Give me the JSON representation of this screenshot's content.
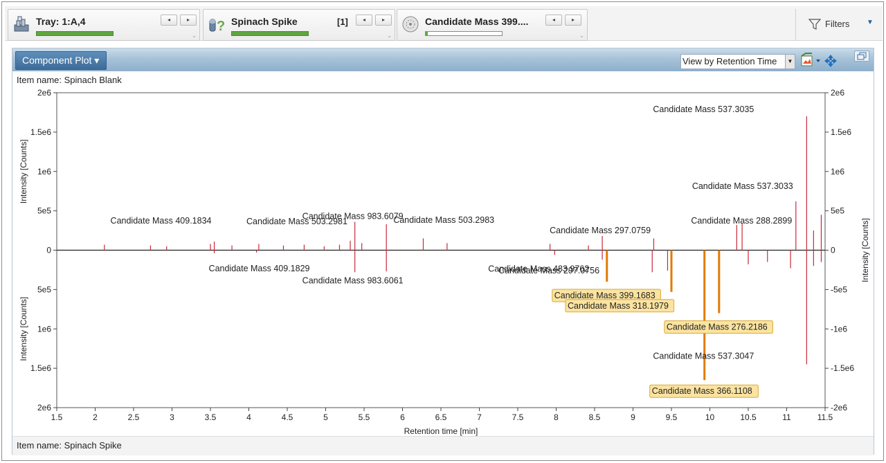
{
  "toolbar": {
    "tray": {
      "title": "Tray: 1:A,4",
      "icon": "tray-stack-icon",
      "progress": 1.0
    },
    "sample": {
      "title": "Spinach Spike",
      "count": "[1]",
      "icon": "sample-question-icon",
      "progress": 1.0
    },
    "component": {
      "title": "Candidate Mass 399....",
      "icon": "disc-icon",
      "progress": 0.03
    },
    "prev_label": "◂",
    "next_label": "▸",
    "filters_label": "Filters",
    "filters_icon": "funnel-icon"
  },
  "panel": {
    "title": "Component Plot ▾",
    "view_select": "View by Retention Time",
    "tool_icons": [
      "export-image-icon",
      "pan-move-icon",
      "restore-window-icon"
    ],
    "item_top": "Item name: Spinach Blank",
    "item_bottom": "Item name: Spinach Spike"
  },
  "chart_data": {
    "type": "bar",
    "xlabel": "Retention time [min]",
    "ylabel_left_top": "Intensity [Counts]",
    "ylabel_left_bottom": "Intensity [Counts]",
    "ylabel_right": "Intensity [Counts]",
    "xlim": [
      1.5,
      11.5
    ],
    "ylim": [
      -2000000,
      2000000
    ],
    "x_ticks": [
      "1.5",
      "2",
      "2.5",
      "3",
      "3.5",
      "4",
      "4.5",
      "5",
      "5.5",
      "6",
      "6.5",
      "7",
      "7.5",
      "8",
      "8.5",
      "9",
      "9.5",
      "10",
      "10.5",
      "11",
      "11.5"
    ],
    "y_ticks_left": [
      "2e6",
      "1.5e6",
      "1e6",
      "5e5",
      "0",
      "5e5",
      "1e6",
      "1.5e6",
      "2e6"
    ],
    "y_ticks_right": [
      "2e6",
      "1.5e6",
      "1e6",
      "5e5",
      "0",
      "-5e5",
      "-1e6",
      "-1.5e6",
      "-2e6"
    ],
    "colors": {
      "peak": "#c8283a",
      "highlight": "#e07b00",
      "label_bg": "#fbe3a0",
      "label_border": "#d9a93a"
    },
    "series": [
      {
        "name": "Spinach Blank",
        "peaks": [
          {
            "x": 2.12,
            "y": 70000
          },
          {
            "x": 2.72,
            "y": 60000
          },
          {
            "x": 2.93,
            "y": 50000
          },
          {
            "x": 3.5,
            "y": 80000
          },
          {
            "x": 3.55,
            "y": 110000,
            "label": "Candidate Mass 409.1834"
          },
          {
            "x": 3.78,
            "y": 60000
          },
          {
            "x": 4.13,
            "y": 80000
          },
          {
            "x": 4.45,
            "y": 60000
          },
          {
            "x": 4.72,
            "y": 70000
          },
          {
            "x": 4.98,
            "y": 50000
          },
          {
            "x": 5.18,
            "y": 70000
          },
          {
            "x": 5.32,
            "y": 120000,
            "label": "Candidate Mass 503.2981"
          },
          {
            "x": 5.38,
            "y": 360000,
            "label": "Candidate Mass 983.6079"
          },
          {
            "x": 5.47,
            "y": 90000
          },
          {
            "x": 5.79,
            "y": 330000,
            "label": "Candidate Mass 503.2983"
          },
          {
            "x": 6.27,
            "y": 150000
          },
          {
            "x": 6.58,
            "y": 90000
          },
          {
            "x": 7.92,
            "y": 80000
          },
          {
            "x": 8.42,
            "y": 60000
          },
          {
            "x": 8.6,
            "y": 180000,
            "label": "Candidate Mass 297.0759"
          },
          {
            "x": 9.27,
            "y": 150000
          },
          {
            "x": 10.35,
            "y": 320000,
            "label": "Candidate Mass 288.2899"
          },
          {
            "x": 10.42,
            "y": 350000
          },
          {
            "x": 11.12,
            "y": 620000,
            "label": "Candidate Mass 537.3033"
          },
          {
            "x": 11.26,
            "y": 1700000,
            "label": "Candidate Mass 537.3035"
          },
          {
            "x": 11.35,
            "y": 250000
          },
          {
            "x": 11.45,
            "y": 450000
          }
        ]
      },
      {
        "name": "Spinach Spike",
        "peaks": [
          {
            "x": 3.55,
            "y": -40000,
            "label": "Candidate Mass 409.1829"
          },
          {
            "x": 4.1,
            "y": -30000
          },
          {
            "x": 5.38,
            "y": -280000,
            "label": "Candidate Mass 983.6061"
          },
          {
            "x": 5.79,
            "y": -270000
          },
          {
            "x": 7.98,
            "y": -60000,
            "label": "Candidate Mass 483.9762"
          },
          {
            "x": 8.6,
            "y": -120000,
            "label": "Candidate Mass 297.0756"
          },
          {
            "x": 8.66,
            "y": -400000,
            "label": "Candidate Mass 399.1683",
            "highlight": true
          },
          {
            "x": 9.25,
            "y": -280000
          },
          {
            "x": 9.45,
            "y": -260000
          },
          {
            "x": 9.5,
            "y": -530000,
            "label": "Candidate Mass 318.1979",
            "highlight": true
          },
          {
            "x": 9.93,
            "y": -1650000,
            "label": "Candidate Mass 366.1108",
            "highlight": true
          },
          {
            "x": 10.12,
            "y": -800000,
            "label": "Candidate Mass 276.2186",
            "highlight": true
          },
          {
            "x": 10.5,
            "y": -180000
          },
          {
            "x": 10.75,
            "y": -150000
          },
          {
            "x": 11.05,
            "y": -230000
          },
          {
            "x": 11.26,
            "y": -1450000,
            "label": "Candidate Mass 537.3047"
          },
          {
            "x": 11.35,
            "y": -200000
          },
          {
            "x": 11.45,
            "y": -150000
          }
        ]
      }
    ]
  }
}
